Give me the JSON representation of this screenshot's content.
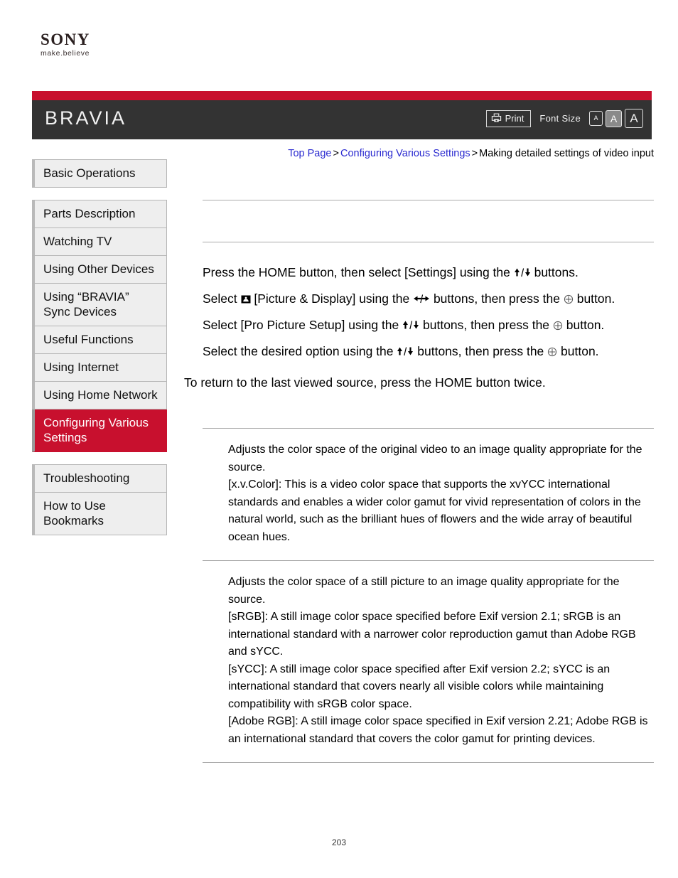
{
  "brand": {
    "logo_word": "SONY",
    "tagline": "make.believe",
    "product_logo": "BRAVIA"
  },
  "header": {
    "print_label": "Print",
    "print_icon": "printer-icon",
    "font_size_label": "Font Size",
    "font_size_options": [
      "A",
      "A",
      "A"
    ],
    "font_size_selected_index": 1,
    "accent_red": "#c8102e",
    "bar_dark": "#333333"
  },
  "breadcrumb": {
    "items": [
      {
        "label": "Top Page",
        "link": true
      },
      {
        "label": "Configuring Various Settings",
        "link": true
      },
      {
        "label": "Making detailed settings of video input",
        "link": false
      }
    ],
    "separator": ">"
  },
  "sidebar": {
    "groups": [
      {
        "items": [
          {
            "label": "Basic Operations",
            "active": false
          }
        ]
      },
      {
        "items": [
          {
            "label": "Parts Description",
            "active": false
          },
          {
            "label": "Watching TV",
            "active": false
          },
          {
            "label": "Using Other Devices",
            "active": false
          },
          {
            "label": "Using “BRAVIA” Sync Devices",
            "active": false
          },
          {
            "label": "Useful Functions",
            "active": false
          },
          {
            "label": "Using Internet",
            "active": false
          },
          {
            "label": "Using Home Network",
            "active": false
          },
          {
            "label": "Configuring Various Settings",
            "active": true
          }
        ]
      },
      {
        "items": [
          {
            "label": "Troubleshooting",
            "active": false
          },
          {
            "label": "How to Use Bookmarks",
            "active": false
          }
        ]
      }
    ]
  },
  "main": {
    "title": "",
    "steps": [
      "Press the HOME button, then select [Settings] using the ⬆/⬇ buttons.",
      "Select ▣ [Picture & Display] using the ⬅/➡ buttons, then press the ⊕ button.",
      "Select [Pro Picture Setup] using the ⬆/⬇ buttons, then press the ⊕ button.",
      "Select the desired option using the ⬆/⬇ buttons, then press the ⊕ button."
    ],
    "step_texts": [
      {
        "pre": "Press the HOME button, then select [Settings] using the ",
        "arrows": "updown",
        "post": " buttons."
      },
      {
        "pre": "Select ",
        "icon": "picture-display-icon",
        "mid": " [Picture & Display] using the ",
        "arrows": "leftright",
        "post": " buttons, then press the ",
        "enter": true,
        "tail": " button."
      },
      {
        "pre": "Select [Pro Picture Setup] using the ",
        "arrows": "updown",
        "post": " buttons, then press the ",
        "enter": true,
        "tail": " button."
      },
      {
        "pre": "Select the desired option using the ",
        "arrows": "updown",
        "post": " buttons, then press the ",
        "enter": true,
        "tail": " button."
      }
    ],
    "return_note": "To return to the last viewed source, press the HOME button twice.",
    "descriptions": [
      {
        "lines": [
          "Adjusts the color space of the original video to an image quality appropriate for the source.",
          "[x.v.Color]: This is a video color space that supports the xvYCC international standards and enables a wider color gamut for vivid representation of colors in the natural world, such as the brilliant hues of flowers and the wide array of beautiful ocean hues."
        ]
      },
      {
        "lines": [
          "Adjusts the color space of a still picture to an image quality appropriate for the source.",
          "[sRGB]: A still image color space specified before Exif version 2.1; sRGB is an international standard with a narrower color reproduction gamut than Adobe RGB and sYCC.",
          "[sYCC]: A still image color space specified after Exif version 2.2; sYCC is an international standard that covers nearly all visible colors while maintaining compatibility with sRGB color space.",
          "[Adobe RGB]: A still image color space specified in Exif version 2.21; Adobe RGB is an international standard that covers the color gamut for printing devices."
        ]
      }
    ]
  },
  "footer": {
    "page_number": "203"
  }
}
